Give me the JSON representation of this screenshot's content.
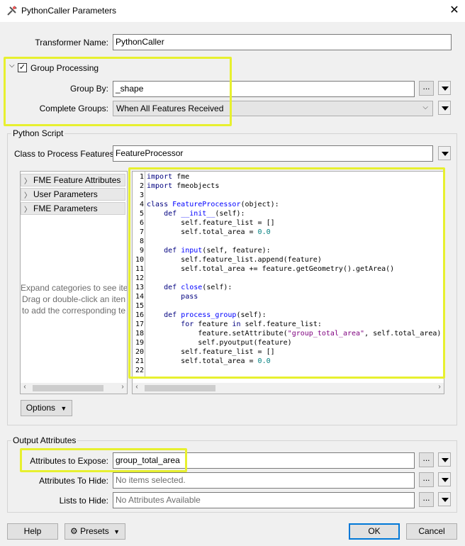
{
  "window": {
    "title": "PythonCaller Parameters",
    "close_glyph": "✕"
  },
  "transformer": {
    "label": "Transformer Name:",
    "value": "PythonCaller"
  },
  "group": {
    "label": "Group Processing",
    "checked": "✓",
    "group_by_label": "Group By:",
    "group_by_value": "_shape",
    "complete_label": "Complete Groups:",
    "complete_value": "When All Features Received"
  },
  "python": {
    "section_title": "Python Script",
    "class_label": "Class to Process Features:",
    "class_value": "FeatureProcessor",
    "categories": [
      "FME Feature Attributes",
      "User Parameters",
      "FME Parameters"
    ],
    "hint": [
      "Expand categories to see iter",
      "Drag or double-click an iten",
      "to add the corresponding te"
    ],
    "code_lines": [
      [
        {
          "t": "import",
          "c": "kw"
        },
        {
          "t": " fme",
          "c": ""
        }
      ],
      [
        {
          "t": "import",
          "c": "kw"
        },
        {
          "t": " fmeobjects",
          "c": ""
        }
      ],
      [],
      [
        {
          "t": "class",
          "c": "kw"
        },
        {
          "t": " ",
          "c": ""
        },
        {
          "t": "FeatureProcessor",
          "c": "cls"
        },
        {
          "t": "(object):",
          "c": ""
        }
      ],
      [
        {
          "t": "    ",
          "c": ""
        },
        {
          "t": "def",
          "c": "kw"
        },
        {
          "t": " ",
          "c": ""
        },
        {
          "t": "__init__",
          "c": "cls"
        },
        {
          "t": "(self):",
          "c": ""
        }
      ],
      [
        {
          "t": "        self.feature_list = []",
          "c": ""
        }
      ],
      [
        {
          "t": "        self.total_area = ",
          "c": ""
        },
        {
          "t": "0.0",
          "c": "num"
        }
      ],
      [],
      [
        {
          "t": "    ",
          "c": ""
        },
        {
          "t": "def",
          "c": "kw"
        },
        {
          "t": " ",
          "c": ""
        },
        {
          "t": "input",
          "c": "cls"
        },
        {
          "t": "(self, feature):",
          "c": ""
        }
      ],
      [
        {
          "t": "        self.feature_list.append(feature)",
          "c": ""
        }
      ],
      [
        {
          "t": "        self.total_area += feature.getGeometry().getArea()",
          "c": ""
        }
      ],
      [],
      [
        {
          "t": "    ",
          "c": ""
        },
        {
          "t": "def",
          "c": "kw"
        },
        {
          "t": " ",
          "c": ""
        },
        {
          "t": "close",
          "c": "cls"
        },
        {
          "t": "(self):",
          "c": ""
        }
      ],
      [
        {
          "t": "        ",
          "c": ""
        },
        {
          "t": "pass",
          "c": "kw"
        }
      ],
      [],
      [
        {
          "t": "    ",
          "c": ""
        },
        {
          "t": "def",
          "c": "kw"
        },
        {
          "t": " ",
          "c": ""
        },
        {
          "t": "process_group",
          "c": "cls"
        },
        {
          "t": "(self):",
          "c": ""
        }
      ],
      [
        {
          "t": "        ",
          "c": ""
        },
        {
          "t": "for",
          "c": "kw"
        },
        {
          "t": " feature ",
          "c": ""
        },
        {
          "t": "in",
          "c": "kw"
        },
        {
          "t": " self.feature_list:",
          "c": ""
        }
      ],
      [
        {
          "t": "            feature.setAttribute(",
          "c": ""
        },
        {
          "t": "\"group_total_area\"",
          "c": "str"
        },
        {
          "t": ", self.total_area)",
          "c": ""
        }
      ],
      [
        {
          "t": "            self.pyoutput(feature)",
          "c": ""
        }
      ],
      [
        {
          "t": "        self.feature_list = []",
          "c": ""
        }
      ],
      [
        {
          "t": "        self.total_area = ",
          "c": ""
        },
        {
          "t": "0.0",
          "c": "num"
        }
      ],
      []
    ],
    "options_label": "Options"
  },
  "output": {
    "section_title": "Output Attributes",
    "expose_label": "Attributes to Expose:",
    "expose_value": "group_total_area",
    "hide_label": "Attributes To Hide:",
    "hide_placeholder": "No items selected.",
    "lists_label": "Lists to Hide:",
    "lists_placeholder": "No Attributes Available"
  },
  "footer": {
    "help": "Help",
    "presets": "Presets",
    "ok": "OK",
    "cancel": "Cancel"
  },
  "ellipsis": "...",
  "colors": {
    "highlight": "#e7f02f",
    "keyword": "#00007f",
    "classname": "#0000ff",
    "string": "#7f007f",
    "number": "#007f7f"
  }
}
